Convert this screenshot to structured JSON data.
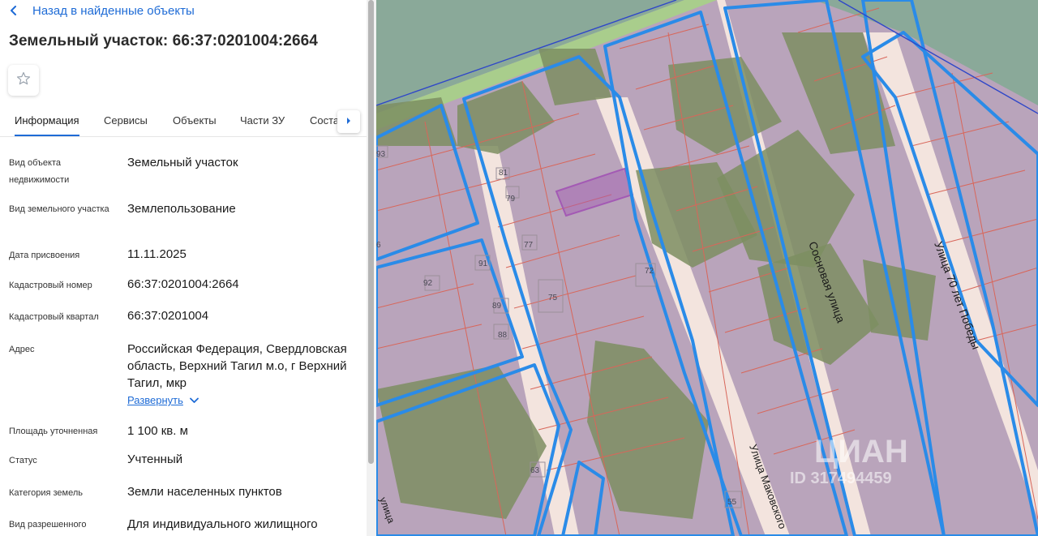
{
  "header": {
    "back_label": "Назад в найденные объекты",
    "title": "Земельный участок: 66:37:0201004:2664"
  },
  "tabs": [
    {
      "label": "Информация",
      "active": true
    },
    {
      "label": "Сервисы"
    },
    {
      "label": "Объекты"
    },
    {
      "label": "Части ЗУ"
    },
    {
      "label": "Соста"
    }
  ],
  "info": {
    "rows": [
      {
        "label": "Вид объекта недвижимости",
        "value": "Земельный участок"
      },
      {
        "label": "Вид земельного участка",
        "value": "Землепользование"
      },
      {
        "label": "Дата присвоения",
        "value": "11.11.2025"
      },
      {
        "label": "Кадастровый номер",
        "value": "66:37:0201004:2664"
      },
      {
        "label": "Кадастровый квартал",
        "value": "66:37:0201004"
      },
      {
        "label": "Адрес",
        "value": "Российская Федерация, Свердловская область, Верхний Тагил м.о, г Верхний Тагил, мкр"
      },
      {
        "label": "Площадь уточненная",
        "value": "1 100 кв. м"
      },
      {
        "label": "Статус",
        "value": "Учтенный"
      },
      {
        "label": "Категория земель",
        "value": "Земли населенных пунктов"
      },
      {
        "label": "Вид разрешенного",
        "value": "Для индивидуального жилищного"
      }
    ],
    "expand_label": "Развернуть"
  },
  "map": {
    "streets": {
      "sosnovaya": "Сосновая улица",
      "pobedy": "Улица 70 лет Победы",
      "makovskogo": "Улица Маковского",
      "left": "улица"
    },
    "plot_numbers": {
      "n81": "81",
      "n79": "79",
      "n77": "77",
      "n75": "75",
      "n72": "72",
      "n93": "93",
      "n91": "91",
      "n92": "92",
      "n89": "89",
      "n88": "88",
      "n63": "63",
      "n55": "55",
      "n6": "6"
    },
    "watermark": "ЦИАН",
    "watermark_id": "ID 317494459",
    "colors": {
      "parcel_fill": "#b9a4bb",
      "block_border": "#2a8be8",
      "parcel_line": "#d8665a",
      "forest": "#7d8e62",
      "grass": "#a9cd8c",
      "road": "#f3e4de",
      "selected": "#a35ab4",
      "dark_green": "#8aa999"
    }
  }
}
